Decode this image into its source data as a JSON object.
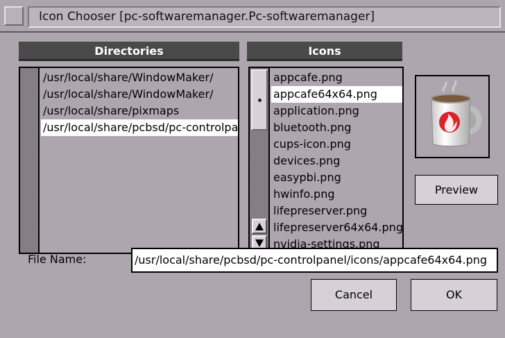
{
  "window": {
    "title": "Icon Chooser [pc-softwaremanager.Pc-softwaremanager]"
  },
  "directories": {
    "header": "Directories",
    "items": [
      "/usr/local/share/WindowMaker/",
      "/usr/local/share/WindowMaker/",
      "/usr/local/share/pixmaps",
      "/usr/local/share/pcbsd/pc-controlpanel/icons"
    ],
    "selected_index": 3
  },
  "icons": {
    "header": "Icons",
    "items": [
      "appcafe.png",
      "appcafe64x64.png",
      "application.png",
      "bluetooth.png",
      "cups-icon.png",
      "devices.png",
      "easypbi.png",
      "hwinfo.png",
      "lifepreserver.png",
      "lifepreserver64x64.png",
      "nvidia-settings.png"
    ],
    "selected_index": 1
  },
  "preview": {
    "button_label": "Preview",
    "image_icon": "mug-icon"
  },
  "file_name": {
    "label": "File Name:",
    "value": "/usr/local/share/pcbsd/pc-controlpanel/icons/appcafe64x64.png"
  },
  "buttons": {
    "cancel": "Cancel",
    "ok": "OK"
  },
  "colors": {
    "background": "#aea6ae",
    "header": "#4b4a4b",
    "selection": "#ffffff",
    "mug_accent": "#d9232a"
  }
}
